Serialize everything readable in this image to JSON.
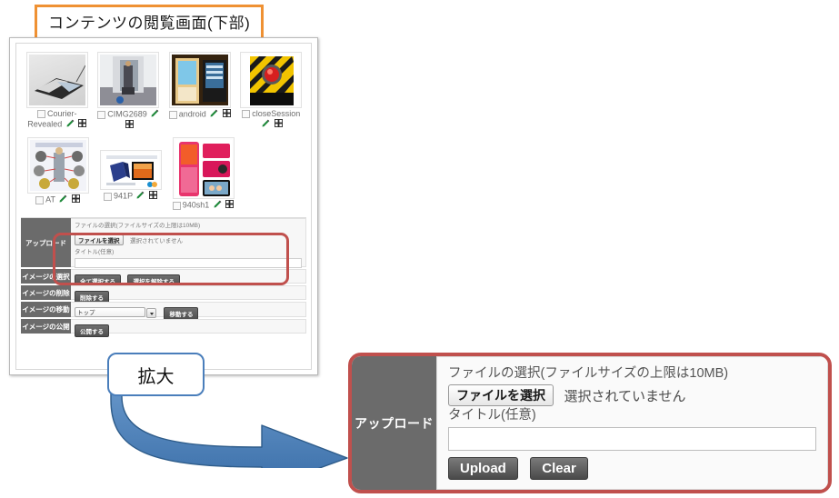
{
  "caption": {
    "text": "コンテンツの閲覧画面(下部)"
  },
  "callout": {
    "text": "拡大"
  },
  "thumbnails": {
    "row1": [
      {
        "label": "Courier-Revealed",
        "art": "pda-organizer",
        "checkbox": false,
        "edit_icon": "edit-pencil-icon",
        "expand_icon": "expand-icon"
      },
      {
        "label": "CIMG2689",
        "art": "robot-hallway",
        "checkbox": false,
        "edit_icon": "edit-pencil-icon",
        "expand_icon": "expand-icon"
      },
      {
        "label": "android",
        "art": "pda-screens",
        "checkbox": false,
        "edit_icon": "edit-pencil-icon",
        "expand_icon": "expand-icon"
      },
      {
        "label": "closeSession",
        "art": "red-button-hazard",
        "checkbox": false,
        "edit_icon": "edit-pencil-icon",
        "expand_icon": "expand-icon"
      }
    ],
    "row2": [
      {
        "label": "AT",
        "art": "diagram-chart",
        "checkbox": false,
        "edit_icon": "edit-pencil-icon",
        "expand_icon": "expand-icon"
      },
      {
        "label": "941P",
        "art": "phone-ad",
        "checkbox": false,
        "edit_icon": "edit-pencil-icon",
        "expand_icon": "expand-icon"
      },
      {
        "label": "940sh1",
        "art": "pink-flip-phone",
        "checkbox": false,
        "edit_icon": "edit-pencil-icon",
        "expand_icon": "expand-icon"
      }
    ]
  },
  "form_rows": {
    "upload": {
      "header": "アップロード",
      "file_label": "ファイルの選択(ファイルサイズの上限は10MB)",
      "file_button": "ファイルを選択",
      "file_status": "選択されていません",
      "title_label": "タイトル(任意)",
      "title_value": "",
      "upload_button": "Upload",
      "clear_button": "Clear"
    },
    "select": {
      "header": "イメージの選択",
      "select_all_button": "全て選択する",
      "deselect_button": "選択を解除する"
    },
    "delete": {
      "header": "イメージの削除",
      "delete_button": "削除する"
    },
    "move": {
      "header": "イメージの移動",
      "destination": "トップ",
      "move_button": "移動する"
    },
    "publish": {
      "header": "イメージの公開",
      "publish_button": "公開する"
    }
  },
  "zoom_panel": {
    "header": "アップロード",
    "file_label": "ファイルの選択(ファイルサイズの上限は10MB)",
    "file_button": "ファイルを選択",
    "file_status": "選択されていません",
    "title_label": "タイトル(任意)",
    "title_value": "",
    "upload_button": "Upload",
    "clear_button": "Clear"
  },
  "colors": {
    "caption_border": "#ef9133",
    "highlight_red": "#c0504d",
    "header_grey": "#6b6b6b",
    "arrow_blue": "#4a7ebb",
    "callout_border": "#4a7ebb"
  }
}
